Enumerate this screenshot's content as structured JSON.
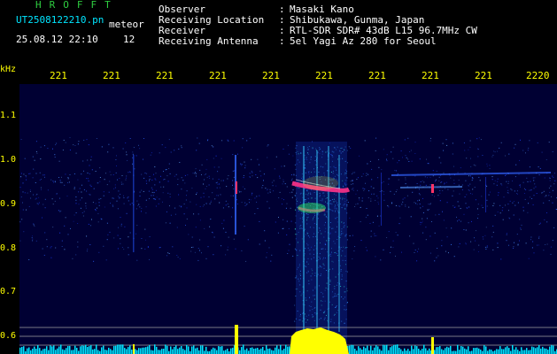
{
  "header": {
    "title": "HROFFT",
    "filename": "UT2508122210.pn",
    "file_type": "meteor",
    "datetime": "25.08.12 22:10",
    "count": "12"
  },
  "info": [
    {
      "label": "Observer",
      "value": "Masaki Kano"
    },
    {
      "label": "Receiving Location",
      "value": "Shibukawa, Gunma, Japan"
    },
    {
      "label": "Receiver",
      "value": "RTL-SDR SDR# 43dB L15 96.7MHz CW"
    },
    {
      "label": "Receiving Antenna",
      "value": "5el Yagi Az 280 for Seoul"
    }
  ],
  "axes": {
    "y_unit": "kHz",
    "y_ticks": [
      "1.1",
      "1.0",
      "0.9",
      "0.8",
      "0.7",
      "0.6"
    ],
    "x_ticks": [
      "221",
      "221",
      "221",
      "221",
      "221",
      "221",
      "221",
      "221",
      "221",
      "2220"
    ]
  },
  "colors": {
    "background": "#000000",
    "accent_yellow": "#ffff00",
    "cyan": "#00e5ff",
    "title_green": "#2ecc40"
  }
}
